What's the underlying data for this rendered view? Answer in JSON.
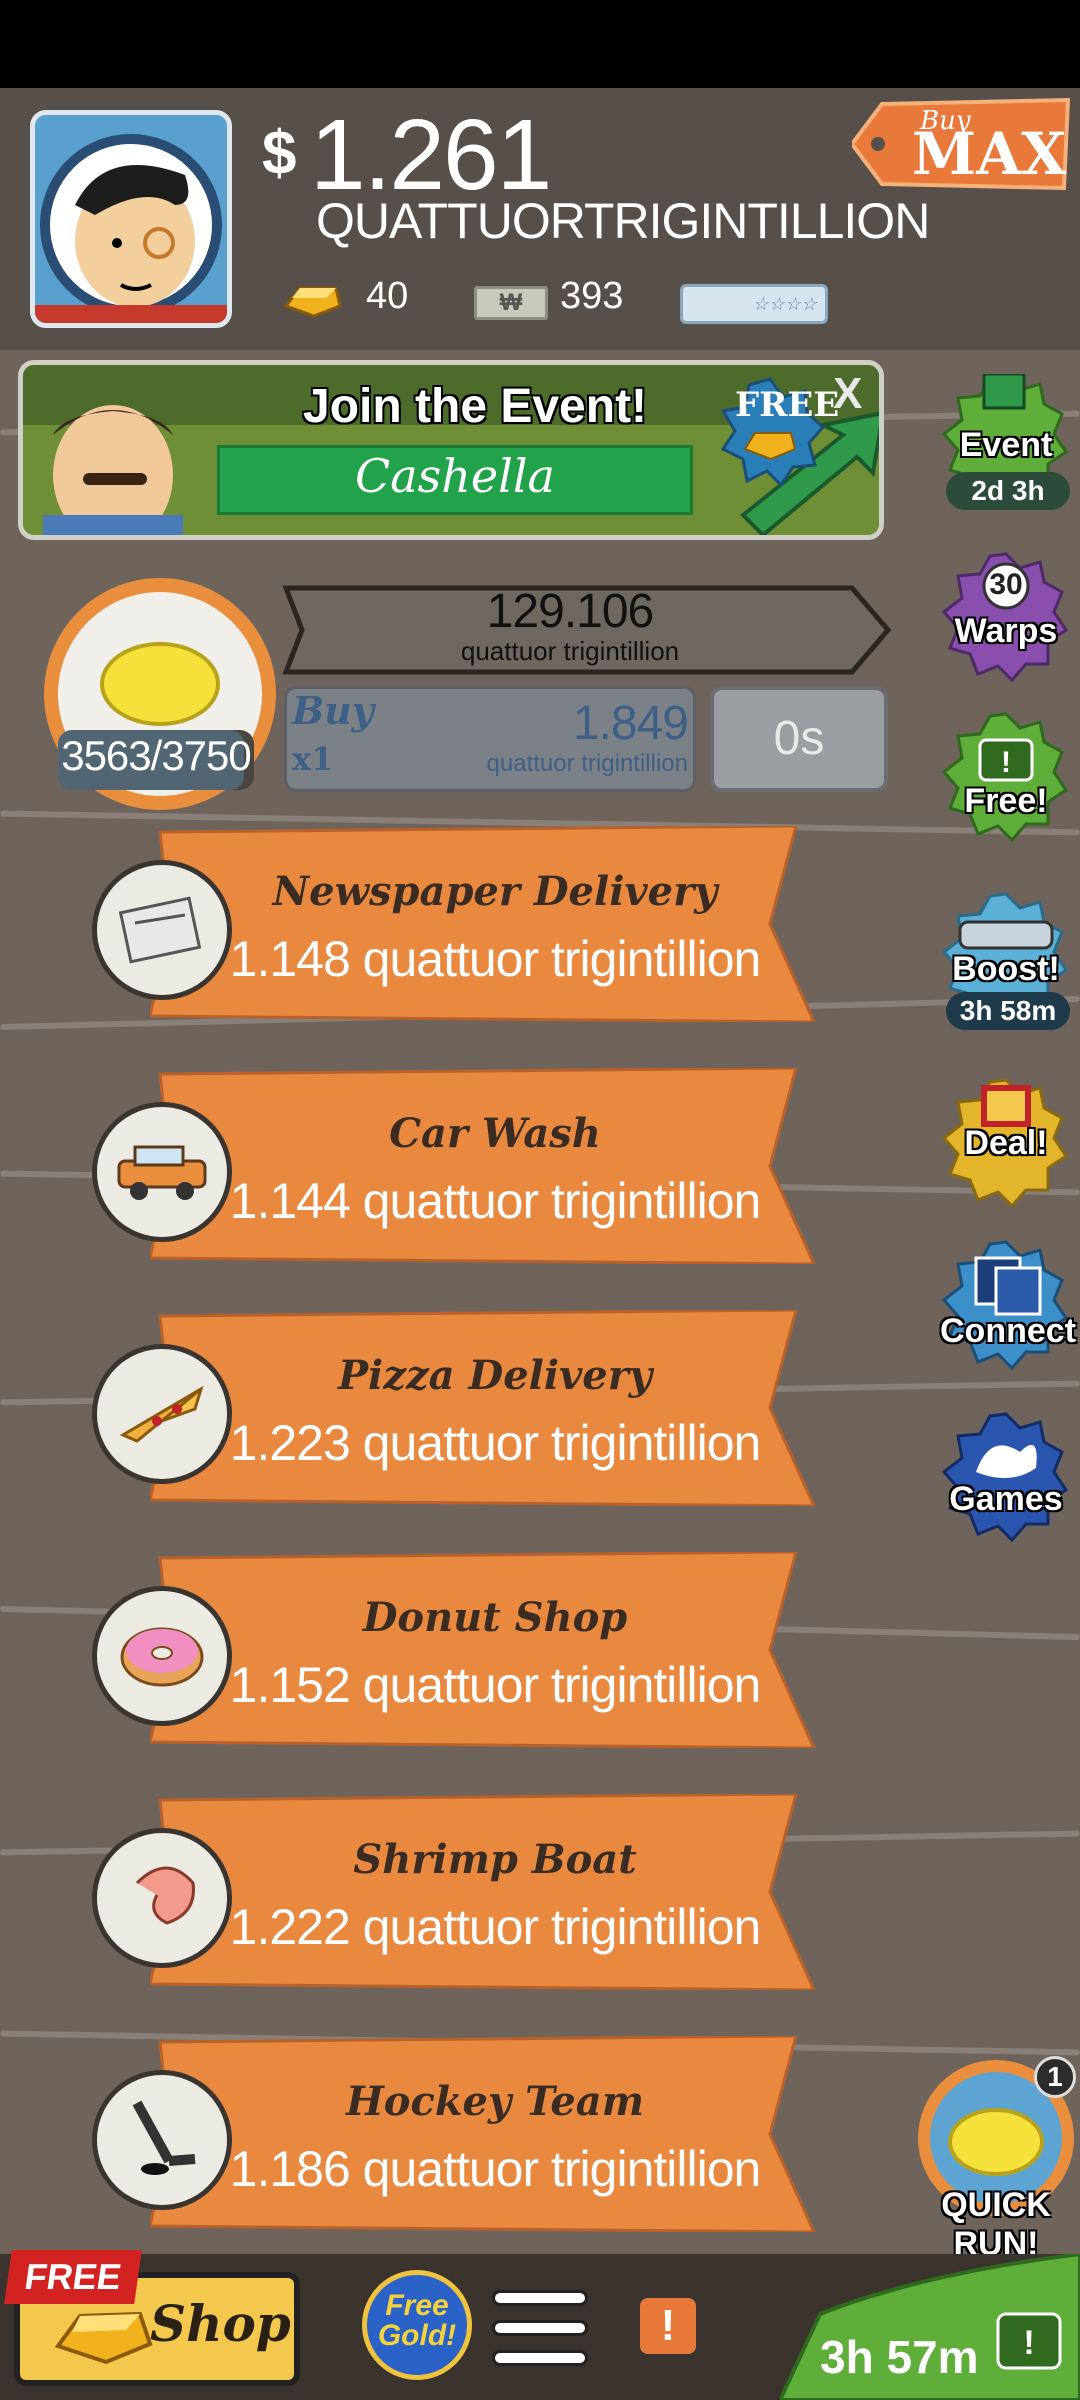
{
  "header": {
    "currency_symbol": "$",
    "money_value": "1.261",
    "money_unit": "QUATTUORTRIGINTILLION",
    "gold_count": "40",
    "megabucks_count": "393",
    "buy_max_top": "Buy",
    "buy_max_bottom": "Max"
  },
  "event_banner": {
    "title": "Join the Event!",
    "event_name": "Cashella",
    "free_label": "FREE",
    "close_label": "X"
  },
  "side_buttons": [
    {
      "label": "Event",
      "timer": "2d 3h",
      "color": "#5fae3a",
      "icon": "party-hat-icon"
    },
    {
      "label": "Warps",
      "count": "30",
      "color": "#8a4fae",
      "icon": "warp-icon"
    },
    {
      "label": "Free!",
      "color": "#5fae3a",
      "icon": "tv-icon"
    },
    {
      "label": "Boost!",
      "timer": "3h 58m",
      "color": "#5ab0d6",
      "icon": "car-icon"
    },
    {
      "label": "Deal!",
      "color": "#e2b52a",
      "icon": "gift-icon"
    },
    {
      "label": "Connect",
      "color": "#3c8fc9",
      "icon": "cards-icon"
    },
    {
      "label": "Games",
      "color": "#2a56b0",
      "icon": "splash-icon"
    }
  ],
  "current_business": {
    "icon": "lemon-icon",
    "progress": "3563/3750",
    "progress_fraction": 0.95,
    "revenue_value": "129.106",
    "revenue_unit": "quattuor trigintillion",
    "buy_label": "Buy",
    "buy_multiplier": "x1",
    "buy_cost": "1.849",
    "buy_unit": "quattuor trigintillion",
    "timer": "0s"
  },
  "businesses": [
    {
      "name": "Newspaper Delivery",
      "value": "1.148 quattuor trigintillion",
      "icon": "newspaper-icon"
    },
    {
      "name": "Car Wash",
      "value": "1.144 quattuor trigintillion",
      "icon": "car-icon"
    },
    {
      "name": "Pizza Delivery",
      "value": "1.223 quattuor trigintillion",
      "icon": "pizza-icon"
    },
    {
      "name": "Donut Shop",
      "value": "1.152 quattuor trigintillion",
      "icon": "donut-icon"
    },
    {
      "name": "Shrimp Boat",
      "value": "1.222 quattuor trigintillion",
      "icon": "shrimp-icon"
    },
    {
      "name": "Hockey Team",
      "value": "1.186 quattuor trigintillion",
      "icon": "hockey-icon"
    }
  ],
  "quick_run": {
    "label": "QUICK RUN!",
    "count": "1"
  },
  "bottom": {
    "free_tag": "FREE",
    "shop_label": "Shop",
    "free_gold_line1": "Free",
    "free_gold_line2": "Gold!",
    "alert_label": "!",
    "timer": "3h 57m"
  }
}
